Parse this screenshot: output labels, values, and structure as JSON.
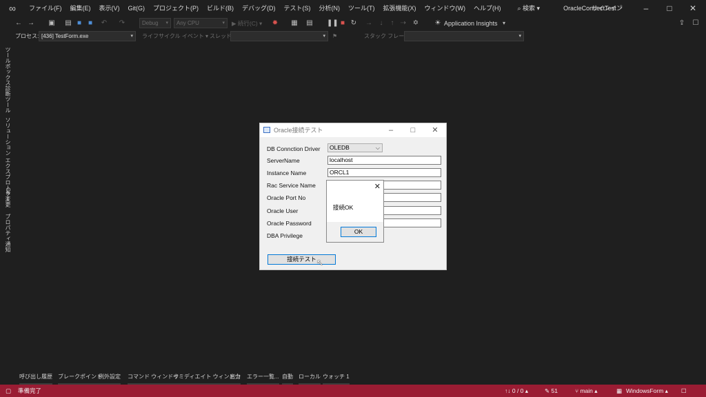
{
  "menubar": {
    "items": [
      "ファイル(F)",
      "編集(E)",
      "表示(V)",
      "Git(G)",
      "プロジェクト(P)",
      "ビルド(B)",
      "デバッグ(D)",
      "テスト(S)",
      "分析(N)",
      "ツール(T)",
      "拡張機能(X)",
      "ウィンドウ(W)",
      "ヘルプ(H)"
    ],
    "search_label": "⌕ 検索 ▾",
    "solution_name": "OracleConnectTest",
    "signin": "サインイン"
  },
  "toolbar": {
    "config": "Debug",
    "platform": "Any CPU",
    "run_label": "▶ 続行(C) ▾",
    "insights": "Application Insights"
  },
  "debugbar": {
    "process_label": "プロセス:",
    "process_value": "[436] TestForm.exe",
    "lifecycle_label": "ライフサイクル イベント ▾",
    "thread_label": "スレッド:",
    "stackframe_label": "スタック フレーム:"
  },
  "side_tabs": [
    "ツールボックス",
    "診断ツール",
    "ソリューション エクスプローラー",
    "Git 変更",
    "プロパティ",
    "通知"
  ],
  "form": {
    "title": "Oracle接続テスト",
    "labels": [
      "DB Connction Driver",
      "ServerName",
      "Instance Name",
      "Rac Service Name",
      "Oracle Port No",
      "Oracle User",
      "Oracle Password",
      "DBA Privilege"
    ],
    "driver_value": "OLEDB",
    "server_value": "localhost",
    "instance_value": "ORCL1",
    "rac_value": "",
    "port_value": "",
    "user_value": "",
    "password_value": "",
    "connect_button": "接続テスト"
  },
  "msgbox": {
    "message": "接続OK",
    "ok_button": "OK"
  },
  "bottom_tabs": [
    "呼び出し履歴",
    "ブレークポイント",
    "例外設定",
    "コマンド ウィンドウ",
    "イミディエイト ウィンドウ",
    "出力",
    "エラー一覧...",
    "自動",
    "ローカル",
    "ウォッチ 1"
  ],
  "statusbar": {
    "ready": "準備完了",
    "lines": "↑↓ 0 / 0 ▴",
    "edits": "✎ 51",
    "branch": "⑂ main ▴",
    "project": "WindowsForm ▴"
  },
  "colors": {
    "statusbar": "#9a1c33",
    "chrome": "#1f1f1f",
    "accent_blue": "#0078d7"
  }
}
